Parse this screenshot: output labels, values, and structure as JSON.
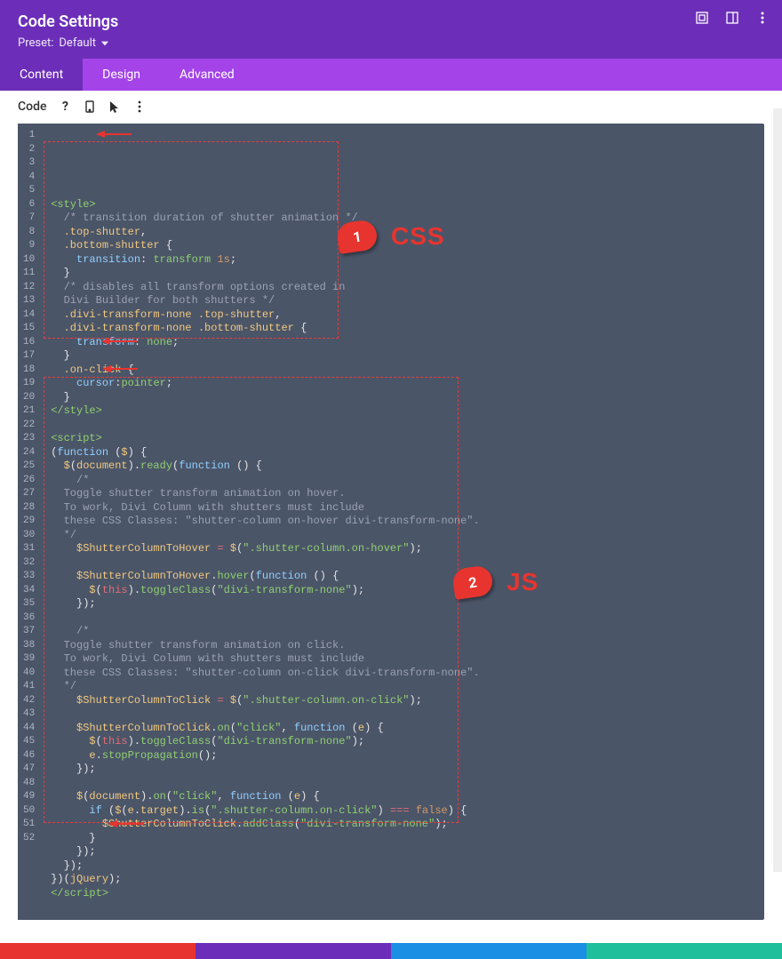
{
  "header": {
    "title": "Code Settings",
    "preset_label_prefix": "Preset:",
    "preset_value": "Default",
    "icons": [
      "expand-icon",
      "panel-layout-icon",
      "more-vert-icon"
    ]
  },
  "tabs": {
    "content": "Content",
    "design": "Design",
    "advanced": "Advanced",
    "active": "content"
  },
  "toolbar": {
    "label": "Code",
    "icons": [
      "help-icon",
      "mobile-icon",
      "cursor-icon",
      "more-vert-icon"
    ]
  },
  "annotations": {
    "css_label": "CSS",
    "js_label": "JS",
    "badge1": "1",
    "badge2": "2"
  },
  "code_lines": [
    {
      "n": 1,
      "html": "<span class='t-tag'>&lt;style&gt;</span>"
    },
    {
      "n": 2,
      "html": "  <span class='t-cmt'>/* transition duration of shutter animation */</span>"
    },
    {
      "n": 3,
      "html": "  <span class='t-sel'>.top-shutter</span><span class='t-pun'>,</span>"
    },
    {
      "n": 4,
      "html": "  <span class='t-sel'>.bottom-shutter</span> <span class='t-pun'>{</span>"
    },
    {
      "n": 5,
      "html": "    <span class='t-prop'>transition</span><span class='t-pun'>:</span> <span class='t-val'>transform</span> <span class='t-num'>1s</span><span class='t-pun'>;</span>"
    },
    {
      "n": 6,
      "html": "  <span class='t-pun'>}</span>"
    },
    {
      "n": 7,
      "html": "  <span class='t-cmt'>/* disables all transform options created in</span>"
    },
    {
      "n": 8,
      "html": "  <span class='t-cmt'>Divi Builder for both shutters */</span>"
    },
    {
      "n": 9,
      "html": "  <span class='t-sel'>.divi-transform-none</span> <span class='t-sel'>.top-shutter</span><span class='t-pun'>,</span>"
    },
    {
      "n": 10,
      "html": "  <span class='t-sel'>.divi-transform-none</span> <span class='t-sel'>.bottom-shutter</span> <span class='t-pun'>{</span>"
    },
    {
      "n": 11,
      "html": "    <span class='t-prop'>transform</span><span class='t-pun'>:</span> <span class='t-val'>none</span><span class='t-pun'>;</span>"
    },
    {
      "n": 12,
      "html": "  <span class='t-pun'>}</span>"
    },
    {
      "n": 13,
      "html": "  <span class='t-sel'>.on-click</span> <span class='t-pun'>{</span>"
    },
    {
      "n": 14,
      "html": "    <span class='t-prop'>cursor</span><span class='t-pun'>:</span><span class='t-val'>pointer</span><span class='t-pun'>;</span>"
    },
    {
      "n": 15,
      "html": "  <span class='t-pun'>}</span>"
    },
    {
      "n": 16,
      "html": "<span class='t-tag'>&lt;/style&gt;</span>"
    },
    {
      "n": 17,
      "html": ""
    },
    {
      "n": 18,
      "html": "<span class='t-tag'>&lt;script&gt;</span>"
    },
    {
      "n": 19,
      "html": "<span class='t-pun'>(</span><span class='t-kw'>function</span> <span class='t-pun'>(</span><span class='t-var'>$</span><span class='t-pun'>) {</span>"
    },
    {
      "n": 20,
      "html": "  <span class='t-var'>$</span><span class='t-pun'>(</span><span class='t-id'>document</span><span class='t-pun'>).</span><span class='t-call'>ready</span><span class='t-pun'>(</span><span class='t-kw'>function</span> <span class='t-pun'>() {</span>"
    },
    {
      "n": 21,
      "html": "    <span class='t-cmt'>/*</span>"
    },
    {
      "n": 22,
      "html": "  <span class='t-cmt'>Toggle shutter transform animation on hover.</span>"
    },
    {
      "n": 23,
      "html": "  <span class='t-cmt'>To work, Divi Column with shutters must include</span>"
    },
    {
      "n": 24,
      "html": "  <span class='t-cmt'>these CSS Classes: \"shutter-column on-hover divi-transform-none\".</span>"
    },
    {
      "n": 25,
      "html": "  <span class='t-cmt'>*/</span>"
    },
    {
      "n": 26,
      "html": "    <span class='t-var'>$ShutterColumnToHover</span> <span class='t-op'>=</span> <span class='t-var'>$</span><span class='t-pun'>(</span><span class='t-str'>\".shutter-column.on-hover\"</span><span class='t-pun'>);</span>"
    },
    {
      "n": 27,
      "html": ""
    },
    {
      "n": 28,
      "html": "    <span class='t-var'>$ShutterColumnToHover</span><span class='t-pun'>.</span><span class='t-call'>hover</span><span class='t-pun'>(</span><span class='t-kw'>function</span> <span class='t-pun'>() {</span>"
    },
    {
      "n": 29,
      "html": "      <span class='t-var'>$</span><span class='t-pun'>(</span><span class='t-this'>this</span><span class='t-pun'>).</span><span class='t-call'>toggleClass</span><span class='t-pun'>(</span><span class='t-str'>\"divi-transform-none\"</span><span class='t-pun'>);</span>"
    },
    {
      "n": 30,
      "html": "    <span class='t-pun'>});</span>"
    },
    {
      "n": 31,
      "html": ""
    },
    {
      "n": 32,
      "html": "    <span class='t-cmt'>/*</span>"
    },
    {
      "n": 33,
      "html": "  <span class='t-cmt'>Toggle shutter transform animation on click.</span>"
    },
    {
      "n": 34,
      "html": "  <span class='t-cmt'>To work, Divi Column with shutters must include</span>"
    },
    {
      "n": 35,
      "html": "  <span class='t-cmt'>these CSS Classes: \"shutter-column on-click divi-transform-none\".</span>"
    },
    {
      "n": 36,
      "html": "  <span class='t-cmt'>*/</span>"
    },
    {
      "n": 37,
      "html": "    <span class='t-var'>$ShutterColumnToClick</span> <span class='t-op'>=</span> <span class='t-var'>$</span><span class='t-pun'>(</span><span class='t-str'>\".shutter-column.on-click\"</span><span class='t-pun'>);</span>"
    },
    {
      "n": 38,
      "html": ""
    },
    {
      "n": 39,
      "html": "    <span class='t-var'>$ShutterColumnToClick</span><span class='t-pun'>.</span><span class='t-call'>on</span><span class='t-pun'>(</span><span class='t-str'>\"click\"</span><span class='t-pun'>,</span> <span class='t-kw'>function</span> <span class='t-pun'>(</span><span class='t-var'>e</span><span class='t-pun'>) {</span>"
    },
    {
      "n": 40,
      "html": "      <span class='t-var'>$</span><span class='t-pun'>(</span><span class='t-this'>this</span><span class='t-pun'>).</span><span class='t-call'>toggleClass</span><span class='t-pun'>(</span><span class='t-str'>\"divi-transform-none\"</span><span class='t-pun'>);</span>"
    },
    {
      "n": 41,
      "html": "      <span class='t-var'>e</span><span class='t-pun'>.</span><span class='t-call'>stopPropagation</span><span class='t-pun'>();</span>"
    },
    {
      "n": 42,
      "html": "    <span class='t-pun'>});</span>"
    },
    {
      "n": 43,
      "html": ""
    },
    {
      "n": 44,
      "html": "    <span class='t-var'>$</span><span class='t-pun'>(</span><span class='t-id'>document</span><span class='t-pun'>).</span><span class='t-call'>on</span><span class='t-pun'>(</span><span class='t-str'>\"click\"</span><span class='t-pun'>,</span> <span class='t-kw'>function</span> <span class='t-pun'>(</span><span class='t-var'>e</span><span class='t-pun'>) {</span>"
    },
    {
      "n": 45,
      "html": "      <span class='t-kw'>if</span> <span class='t-pun'>(</span><span class='t-var'>$</span><span class='t-pun'>(</span><span class='t-var'>e</span><span class='t-pun'>.</span><span class='t-id'>target</span><span class='t-pun'>).</span><span class='t-call'>is</span><span class='t-pun'>(</span><span class='t-str'>\".shutter-column.on-click\"</span><span class='t-pun'>)</span> <span class='t-op'>===</span> <span class='t-bool'>false</span><span class='t-pun'>) {</span>"
    },
    {
      "n": 46,
      "html": "        <span class='t-var'>$ShutterColumnToClick</span><span class='t-pun'>.</span><span class='t-call'>addClass</span><span class='t-pun'>(</span><span class='t-str'>\"divi-transform-none\"</span><span class='t-pun'>);</span>"
    },
    {
      "n": 47,
      "html": "      <span class='t-pun'>}</span>"
    },
    {
      "n": 48,
      "html": "    <span class='t-pun'>});</span>"
    },
    {
      "n": 49,
      "html": "  <span class='t-pun'>});</span>"
    },
    {
      "n": 50,
      "html": "<span class='t-pun'>})(</span><span class='t-id'>jQuery</span><span class='t-pun'>);</span>"
    },
    {
      "n": 51,
      "html": "<span class='t-tag'>&lt;/script&gt;</span>"
    },
    {
      "n": 52,
      "html": ""
    }
  ]
}
